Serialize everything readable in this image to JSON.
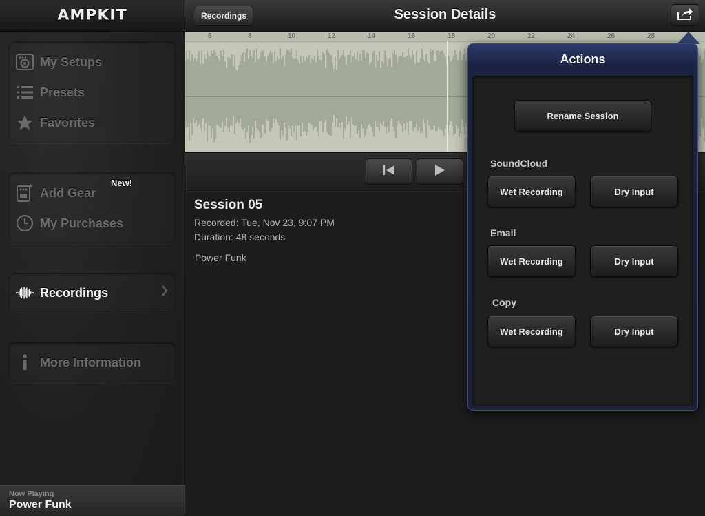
{
  "sidebar": {
    "logo": "AMPKIT",
    "group1": [
      {
        "label": "My Setups",
        "icon": "amp-setup-icon"
      },
      {
        "label": "Presets",
        "icon": "list-icon"
      },
      {
        "label": "Favorites",
        "icon": "star-icon"
      }
    ],
    "group2": [
      {
        "label": "Add Gear",
        "icon": "pedal-icon",
        "badge": "New!"
      },
      {
        "label": "My Purchases",
        "icon": "clock-icon"
      }
    ],
    "recordings": {
      "label": "Recordings",
      "icon": "waveform-icon"
    },
    "more_info": {
      "label": "More Information",
      "icon": "info-icon"
    },
    "now_playing": {
      "label": "Now Playing",
      "title": "Power Funk"
    }
  },
  "topbar": {
    "back_label": "Recordings",
    "title": "Session Details",
    "share_icon": "share-icon"
  },
  "waveform": {
    "ruler_ticks": [
      "6",
      "8",
      "10",
      "12",
      "14",
      "16",
      "18",
      "20",
      "22",
      "24",
      "26",
      "28"
    ]
  },
  "session": {
    "title": "Session 05",
    "recorded": "Recorded: Tue, Nov 23, 9:07 PM",
    "duration": "Duration: 48 seconds",
    "preset": "Power Funk"
  },
  "actions": {
    "title": "Actions",
    "rename": "Rename Session",
    "soundcloud": {
      "label": "SoundCloud",
      "wet": "Wet Recording",
      "dry": "Dry Input"
    },
    "email": {
      "label": "Email",
      "wet": "Wet Recording",
      "dry": "Dry Input"
    },
    "copy": {
      "label": "Copy",
      "wet": "Wet Recording",
      "dry": "Dry Input"
    }
  },
  "colors": {
    "popover_header": "#1b2343",
    "waveform_bg": "#c4c8b8",
    "waveform_fg": "#7f8a7a"
  }
}
